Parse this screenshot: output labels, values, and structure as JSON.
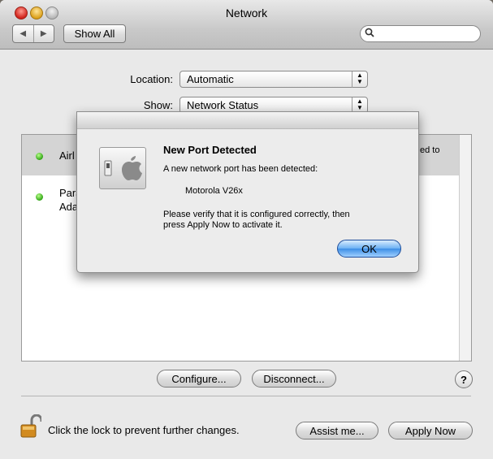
{
  "window": {
    "title": "Network",
    "nav_back": "◀",
    "nav_forward": "▶",
    "show_all_label": "Show All",
    "search_placeholder": ""
  },
  "location": {
    "label": "Location:",
    "value": "Automatic"
  },
  "show": {
    "label": "Show:",
    "value": "Network Status"
  },
  "ports": [
    {
      "name": "Airl",
      "status_color": "#2fa314",
      "trailing": "ed to"
    },
    {
      "name_line1": "Para",
      "name_line2": "Ada",
      "status_color": "#2fa314"
    }
  ],
  "buttons": {
    "configure": "Configure...",
    "disconnect": "Disconnect...",
    "help": "?",
    "assist": "Assist me...",
    "apply": "Apply Now"
  },
  "lock_message": "Click the lock to prevent further changes.",
  "dialog": {
    "title": "New Port Detected",
    "line1": "A new network port has been detected:",
    "device": "Motorola V26x",
    "line2a": "Please verify that it is configured correctly, then",
    "line2b": "press Apply Now to activate it.",
    "ok_label": "OK"
  },
  "icons": [
    "search-icon",
    "lock-icon",
    "apple-logo-icon",
    "switch-icon",
    "status-dot-icon",
    "help-icon"
  ]
}
